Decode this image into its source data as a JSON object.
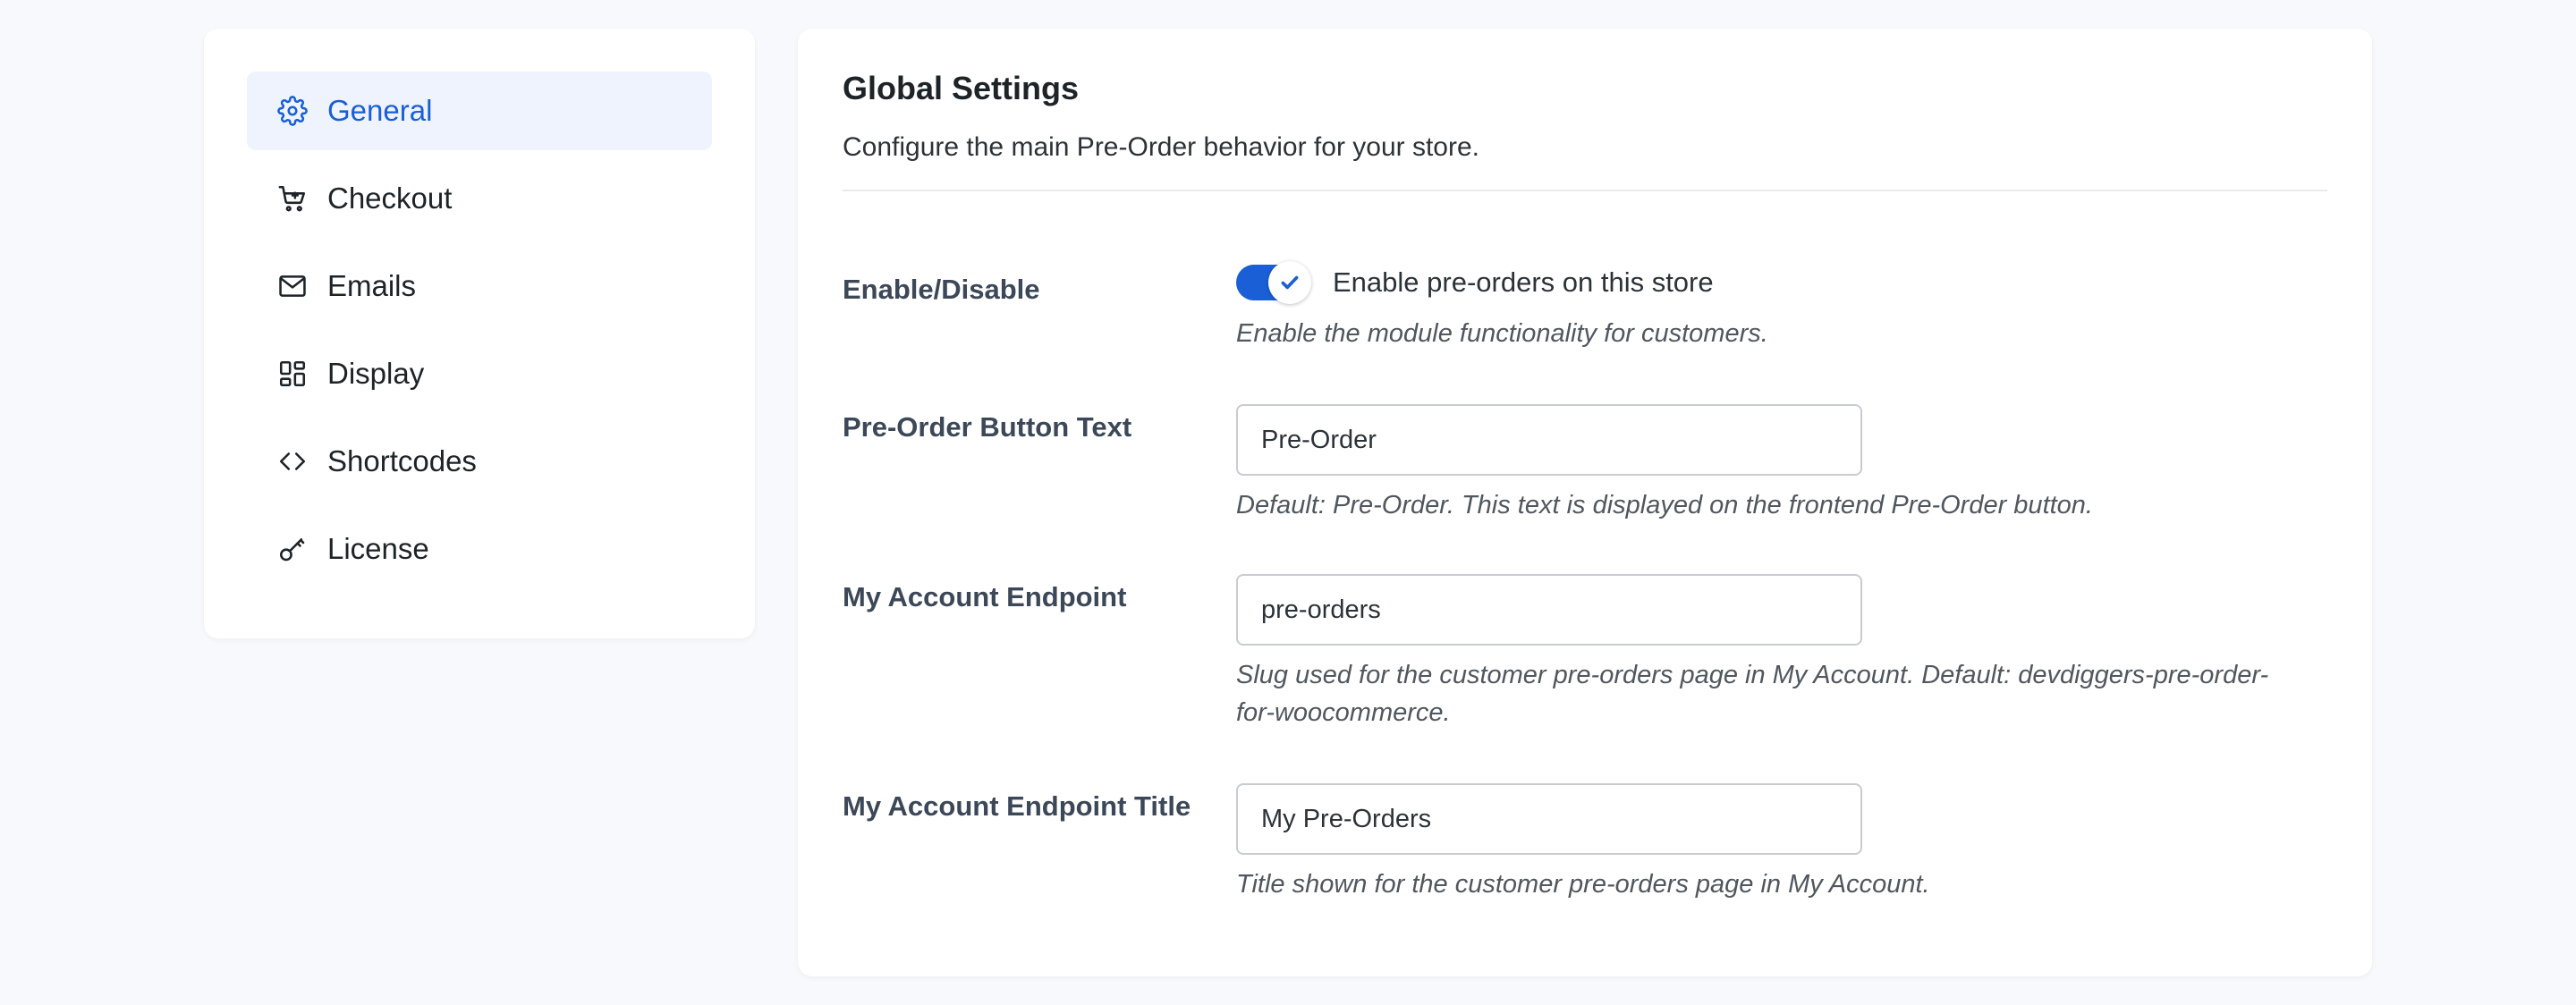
{
  "sidebar": {
    "items": [
      {
        "label": "General",
        "icon": "gear-icon",
        "active": true
      },
      {
        "label": "Checkout",
        "icon": "cart-icon",
        "active": false
      },
      {
        "label": "Emails",
        "icon": "envelope-icon",
        "active": false
      },
      {
        "label": "Display",
        "icon": "dashboard-icon",
        "active": false
      },
      {
        "label": "Shortcodes",
        "icon": "code-icon",
        "active": false
      },
      {
        "label": "License",
        "icon": "key-icon",
        "active": false
      }
    ]
  },
  "panel": {
    "title": "Global Settings",
    "description": "Configure the main Pre-Order behavior for your store.",
    "enable": {
      "label": "Enable/Disable",
      "toggle_text": "Enable pre-orders on this store",
      "checked": true,
      "help": "Enable the module functionality for customers."
    },
    "button_text": {
      "label": "Pre-Order Button Text",
      "value": "Pre-Order",
      "help": "Default: Pre-Order. This text is displayed on the frontend Pre-Order button."
    },
    "endpoint": {
      "label": "My Account Endpoint",
      "value": "pre-orders",
      "help": "Slug used for the customer pre-orders page in My Account. Default: devdiggers-pre-order-for-woocommerce."
    },
    "endpoint_title": {
      "label": "My Account Endpoint Title",
      "value": "My Pre-Orders",
      "help": "Title shown for the customer pre-orders page in My Account."
    }
  },
  "colors": {
    "accent": "#1a5fd6",
    "active_bg": "#eef3fe",
    "page_bg": "#f8f9fc"
  }
}
